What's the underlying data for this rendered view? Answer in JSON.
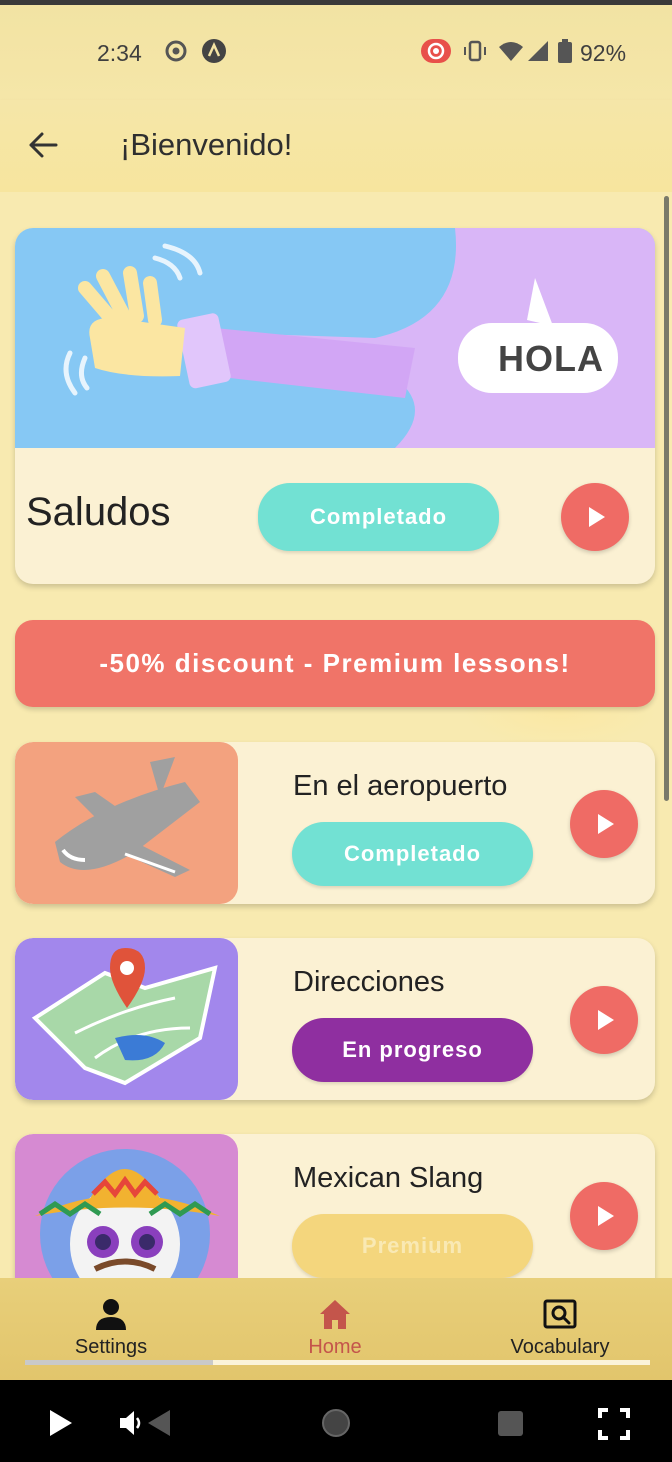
{
  "status_bar": {
    "time": "2:34",
    "battery": "92%"
  },
  "app_bar": {
    "title": "¡Bienvenido!"
  },
  "hero_lesson": {
    "bubble_text": "HOLA",
    "name": "Saludos",
    "status": "Completado"
  },
  "promo": {
    "text": "-50% discount - Premium lessons!"
  },
  "lessons": [
    {
      "name": "En el aeropuerto",
      "status": "Completado"
    },
    {
      "name": "Direcciones",
      "status": "En progreso"
    },
    {
      "name": "Mexican Slang",
      "status": "Premium"
    }
  ],
  "bottom_nav": {
    "items": [
      {
        "label": "Settings",
        "icon": "person-icon"
      },
      {
        "label": "Home",
        "icon": "home-icon",
        "active": true
      },
      {
        "label": "Vocabulary",
        "icon": "search-box-icon"
      }
    ]
  },
  "video_progress": 0.3,
  "colors": {
    "accent_red": "#ef6b65",
    "completed": "#72e1d3",
    "in_progress": "#8f2fa0",
    "premium": "#f4d67d",
    "nav_active": "#c4554b"
  }
}
